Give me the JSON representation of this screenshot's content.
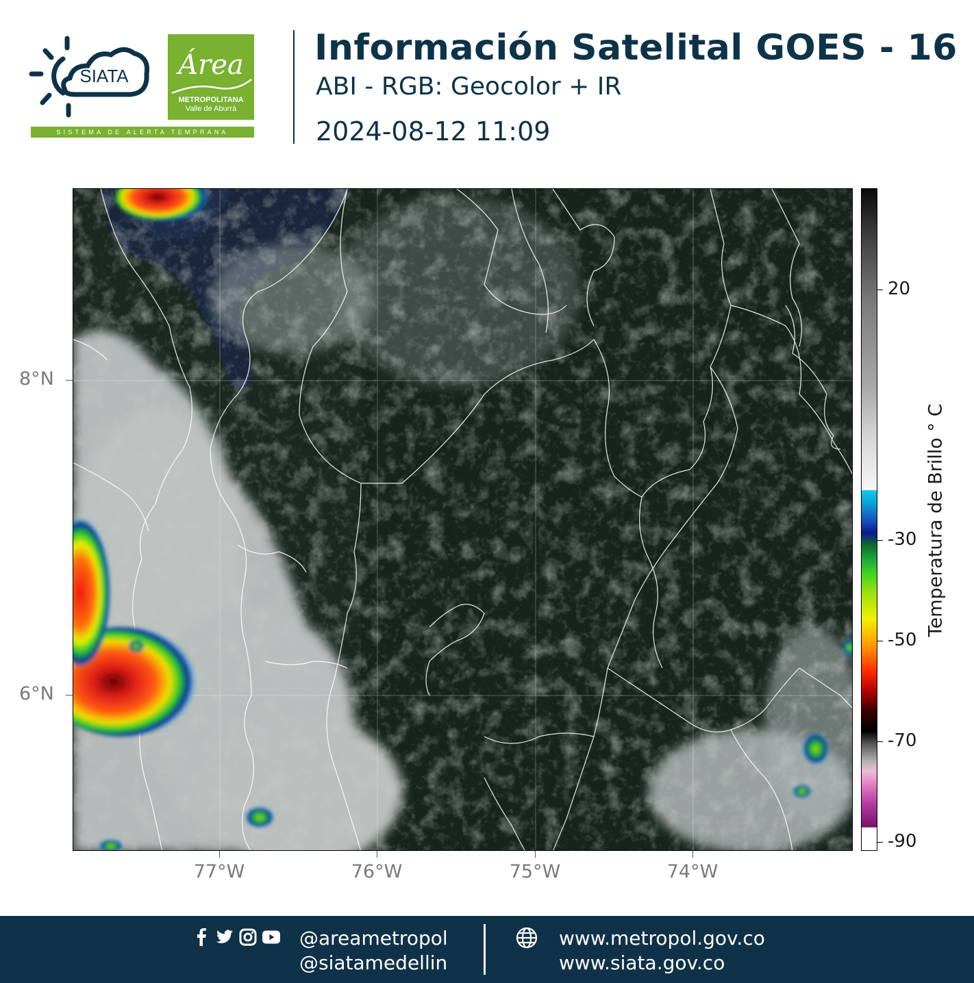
{
  "header": {
    "title": "Información Satelital GOES - 16",
    "subtitle": "ABI - RGB: Geocolor + IR",
    "timestamp": "2024-08-12 11:09"
  },
  "logos": {
    "siata_text": "SIATA",
    "siata_tagline": "SISTEMA DE ALERTA TEMPRANA",
    "area_script": "Área",
    "area_line1": "METROPOLITANA",
    "area_line2": "Valle de Aburrá",
    "brand_green": "#79b130",
    "brand_navy": "#0d3349"
  },
  "map": {
    "latitude_labels": [
      "8°N",
      "6°N"
    ],
    "longitude_labels": [
      "77°W",
      "76°W",
      "75°W",
      "74°W"
    ]
  },
  "colorbar": {
    "title": "Temperatura de Brillo ° C",
    "tick_labels": [
      "20",
      "-30",
      "-50",
      "-70",
      "-90"
    ]
  },
  "footer": {
    "social_icons": [
      "facebook-icon",
      "twitter-icon",
      "instagram-icon",
      "youtube-icon"
    ],
    "handles": [
      "@areametropol",
      "@siatamedellin"
    ],
    "urls": [
      "www.metropol.gov.co",
      "www.siata.gov.co"
    ],
    "background": "#103248"
  }
}
